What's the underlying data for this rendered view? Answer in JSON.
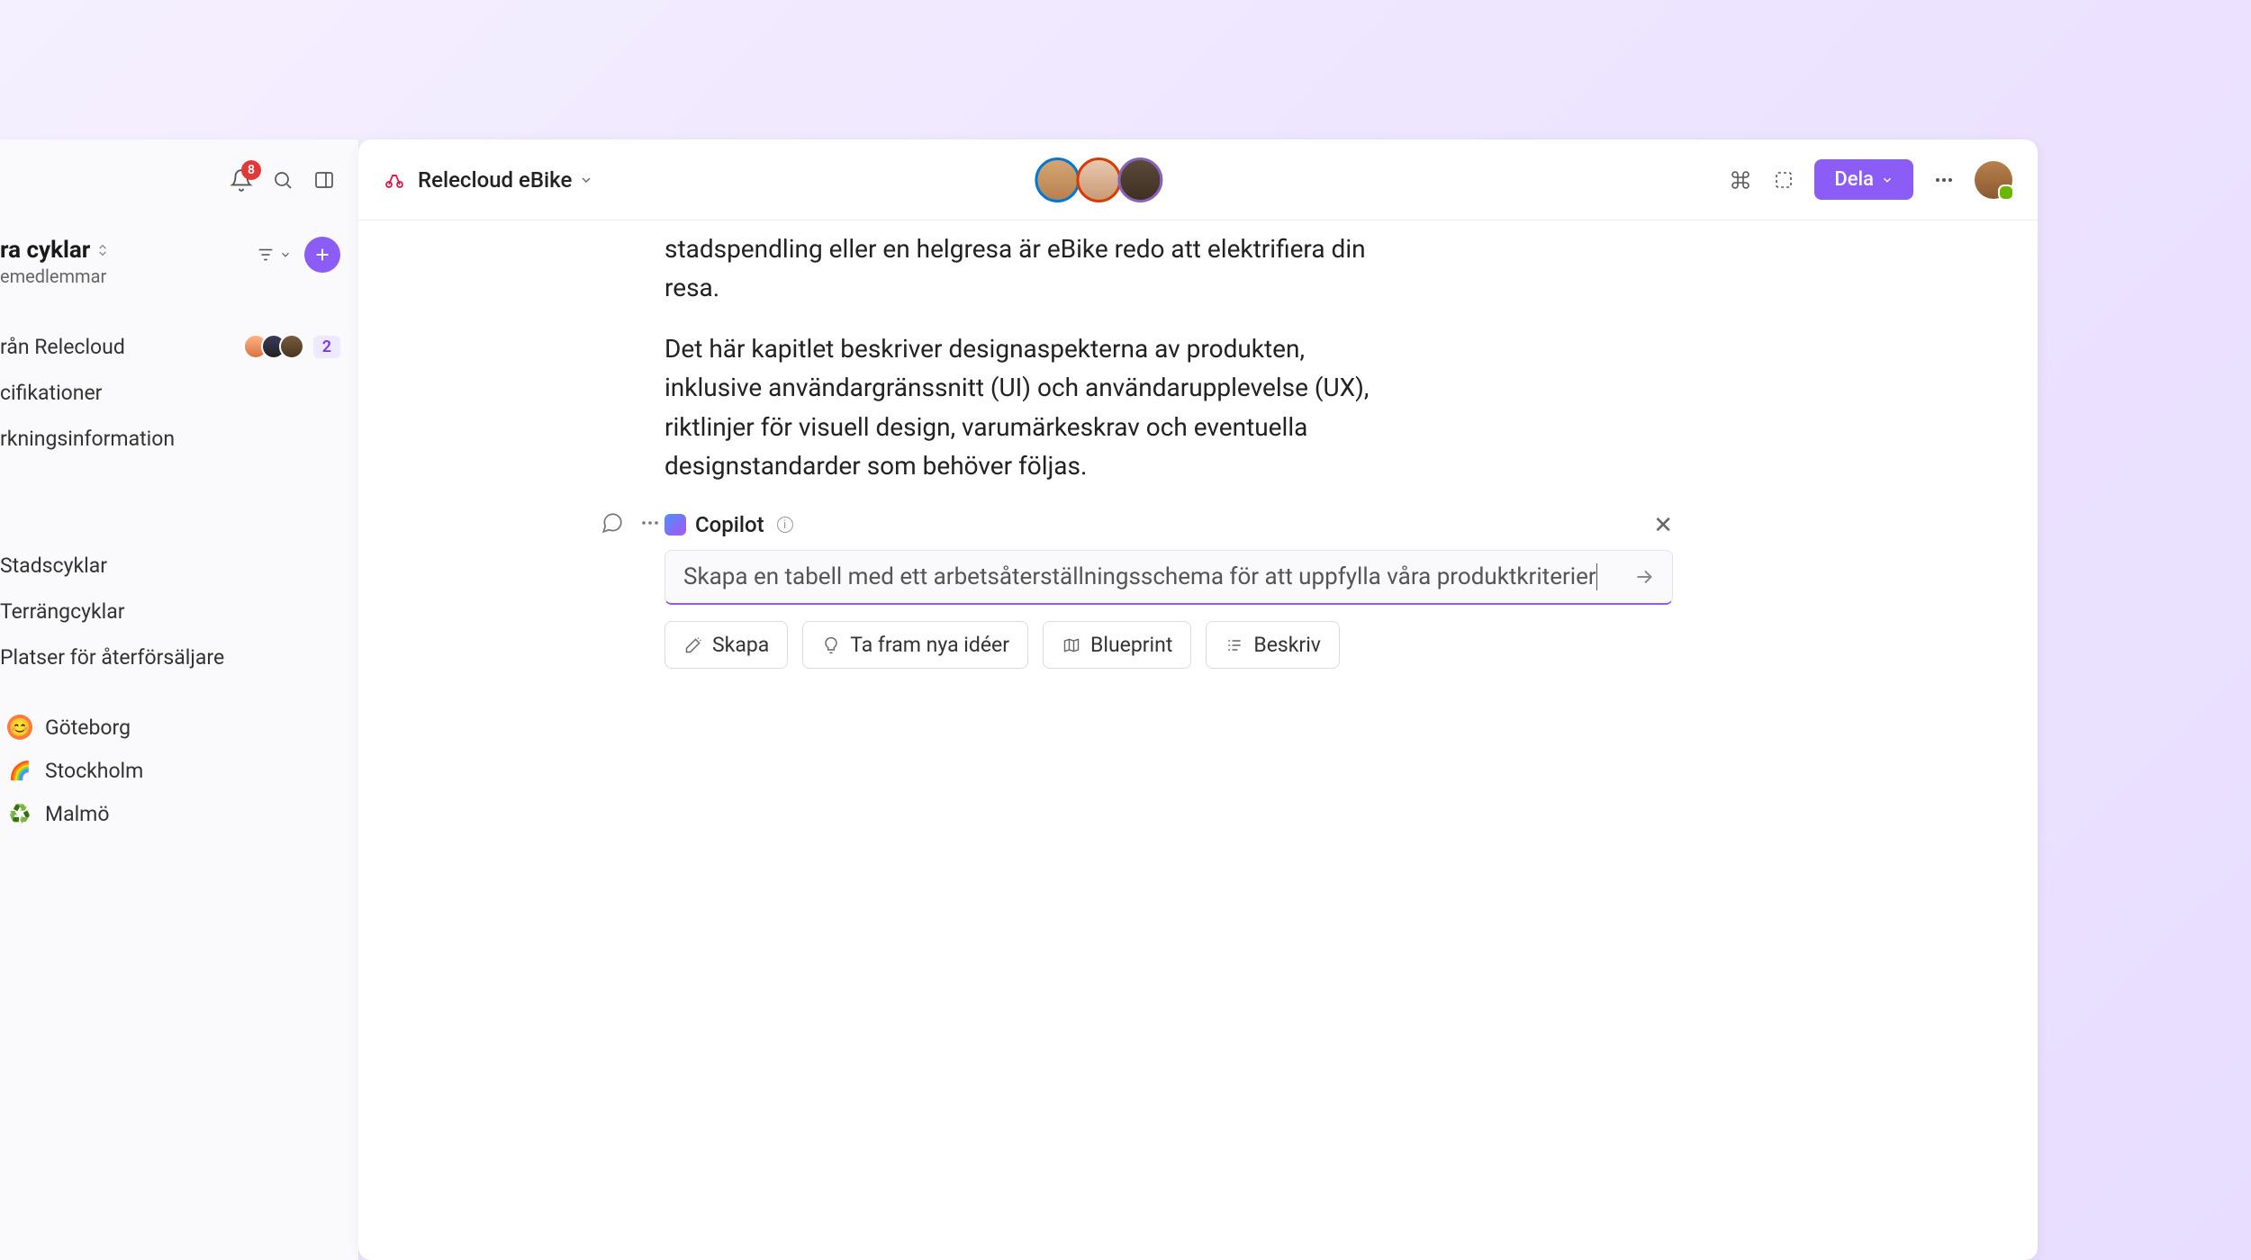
{
  "sidebar": {
    "notification_count": "8",
    "workspace_title": "ra cyklar",
    "workspace_subtitle": "emedlemmar",
    "items": {
      "relecloud": "rån Relecloud",
      "relecloud_badge": "2",
      "specs": "cifikationer",
      "manufacturing": "rkningsinformation"
    },
    "section2": {
      "city_bikes": "Stadscyklar",
      "terrain_bikes": "Terrängcyklar",
      "reseller_places": "Platser för återförsäljare"
    },
    "cities": {
      "goteborg": "Göteborg",
      "stockholm": "Stockholm",
      "malmo": "Malmö"
    }
  },
  "toolbar": {
    "doc_title": "Relecloud eBike",
    "share_label": "Dela"
  },
  "body": {
    "para1": "stadspendling eller en helgresa är eBike redo att elektrifiera din resa.",
    "para2": "Det här kapitlet beskriver designaspekterna av produkten, inklusive användargränssnitt (UI) och användarupplevelse (UX), riktlinjer för visuell design, varumärkeskrav och eventuella designstandarder som behöver följas."
  },
  "copilot": {
    "name": "Copilot",
    "input_text": "Skapa en tabell med ett arbetsåterställningsschema för att uppfylla våra produktkriterier",
    "chips": {
      "create": "Skapa",
      "ideas": "Ta fram nya idéer",
      "blueprint": "Blueprint",
      "describe": "Beskriv"
    }
  }
}
